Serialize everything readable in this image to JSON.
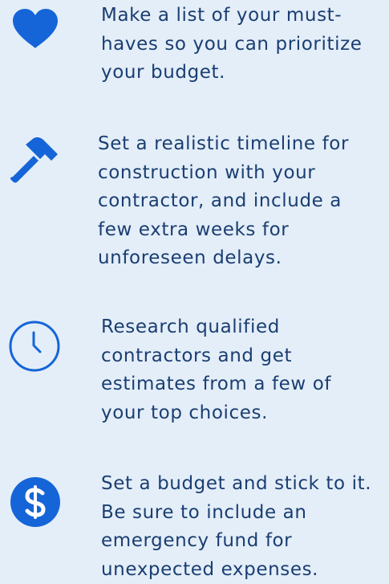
{
  "colors": {
    "background": "#e4eef8",
    "icon_blue": "#1565d8",
    "text_navy": "#1a3e72"
  },
  "tips": [
    {
      "icon": "heart-icon",
      "text": "Make a list of your must-haves so you can prioritize your budget."
    },
    {
      "icon": "hammer-icon",
      "text": "Set a realistic timeline for construction with your contractor, and include a few extra weeks for unforeseen delays."
    },
    {
      "icon": "clock-icon",
      "text": "Research qualified contractors and get estimates from a few of your top choices."
    },
    {
      "icon": "dollar-icon",
      "text": "Set a budget and stick to it. Be sure to include an emergency fund for unexpected expenses."
    }
  ]
}
